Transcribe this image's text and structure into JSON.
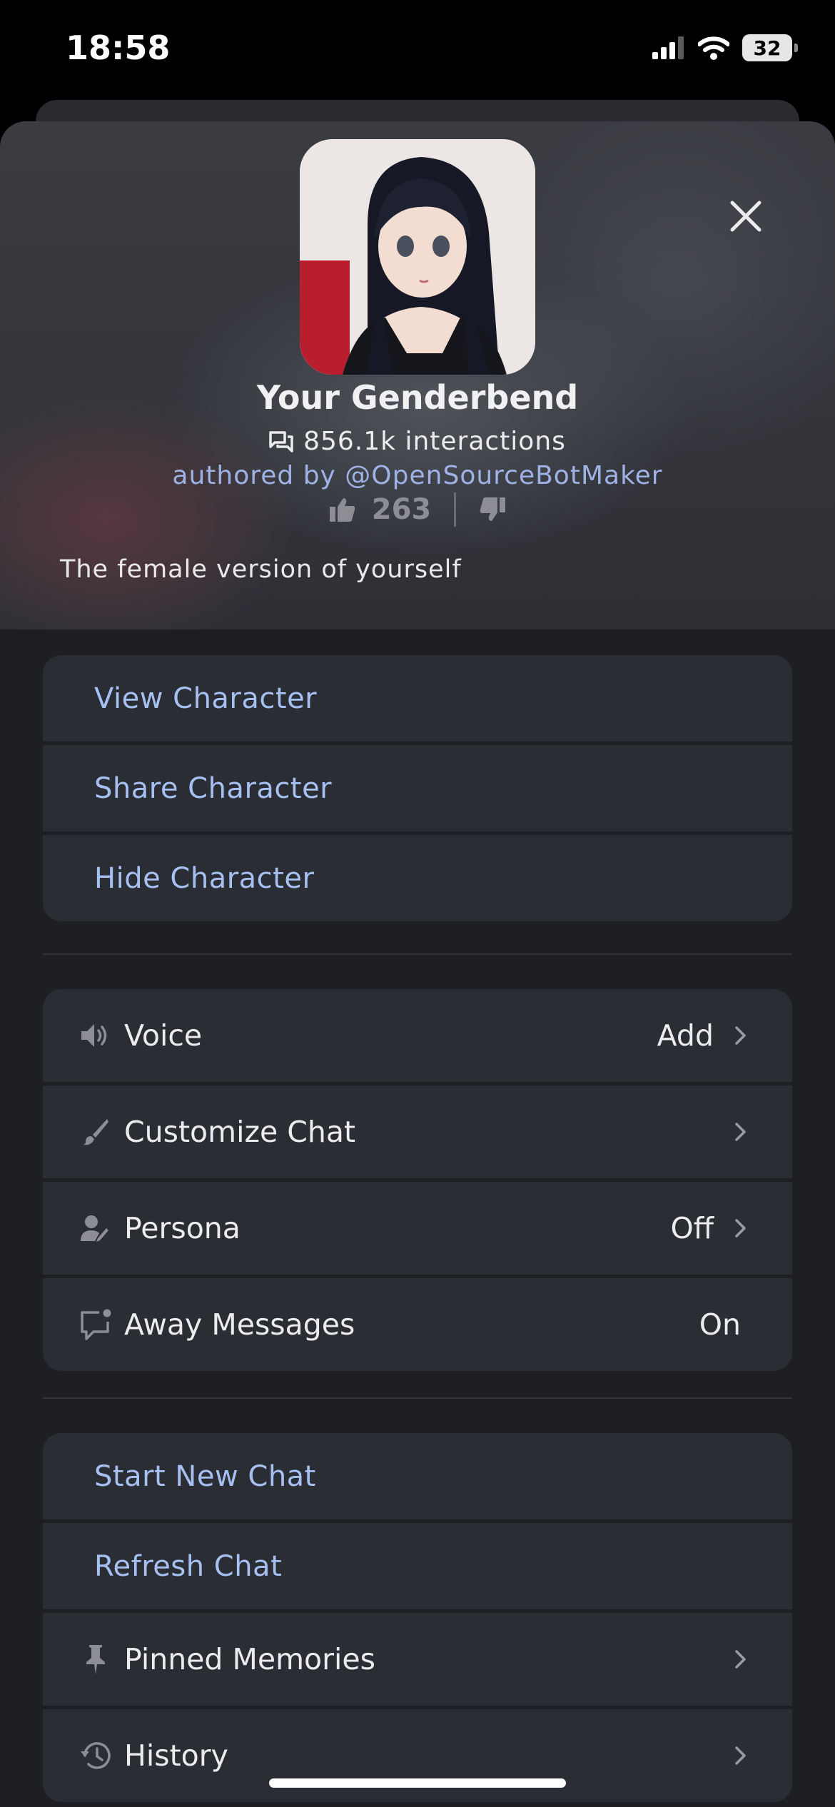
{
  "status_bar": {
    "time": "18:58",
    "battery": "32"
  },
  "character": {
    "name": "Your Genderbend",
    "interactions": "856.1k interactions",
    "author": "authored by @OpenSourceBotMaker",
    "likes": "263",
    "description": "The female version of yourself"
  },
  "actions_top": [
    {
      "label": "View Character"
    },
    {
      "label": "Share Character"
    },
    {
      "label": "Hide Character"
    }
  ],
  "settings": [
    {
      "label": "Voice",
      "value": "Add",
      "icon": "speaker-icon"
    },
    {
      "label": "Customize Chat",
      "value": "",
      "icon": "brush-icon"
    },
    {
      "label": "Persona",
      "value": "Off",
      "icon": "persona-icon"
    },
    {
      "label": "Away Messages",
      "value": "On",
      "icon": "message-notification-icon"
    }
  ],
  "actions_bottom": [
    {
      "label": "Start New Chat"
    },
    {
      "label": "Refresh Chat"
    },
    {
      "label": "Pinned Memories",
      "icon": "pin-icon"
    },
    {
      "label": "History",
      "icon": "history-icon"
    }
  ],
  "colors": {
    "accent_link": "#a7c0f2",
    "row_bg": "#2b2d34",
    "sheet_bg": "#1e1f23"
  }
}
